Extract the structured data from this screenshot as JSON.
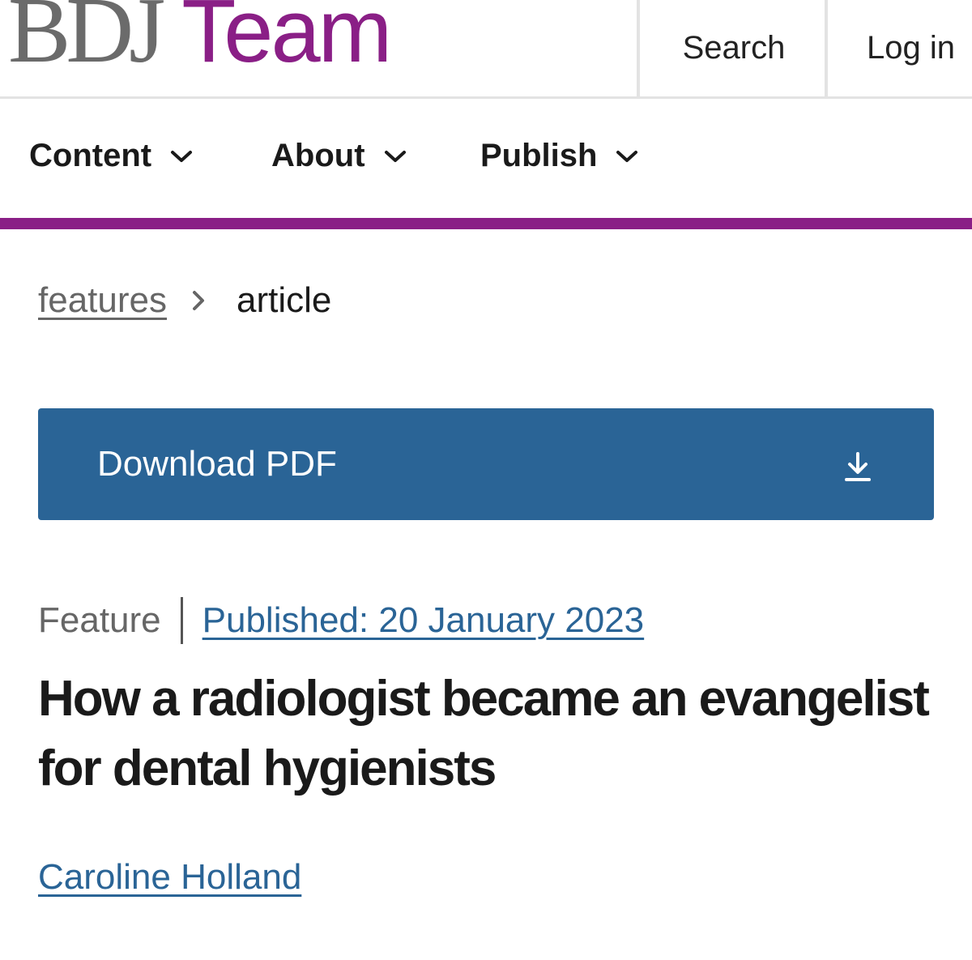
{
  "header": {
    "logo_prefix": "BDJ",
    "logo_suffix": "Team",
    "search_label": "Search",
    "login_label": "Log in"
  },
  "nav": {
    "items": [
      {
        "label": "Content",
        "icon": "chevron-down-icon"
      },
      {
        "label": "About",
        "icon": "chevron-down-icon"
      },
      {
        "label": "Publish",
        "icon": "chevron-down-icon"
      }
    ]
  },
  "breadcrumb": {
    "parent": "features",
    "separator_icon": "chevron-right-icon",
    "current": "article"
  },
  "download": {
    "label": "Download PDF",
    "icon": "download-icon"
  },
  "article": {
    "type": "Feature",
    "published": "Published: 20 January 2023",
    "title": "How a radiologist became an evangelist for dental hygienists",
    "author": "Caroline Holland"
  },
  "colors": {
    "brand_purple": "#8a1f86",
    "logo_gray": "#6b6b6b",
    "button_blue": "#2a6496",
    "link_blue": "#2a6496"
  }
}
